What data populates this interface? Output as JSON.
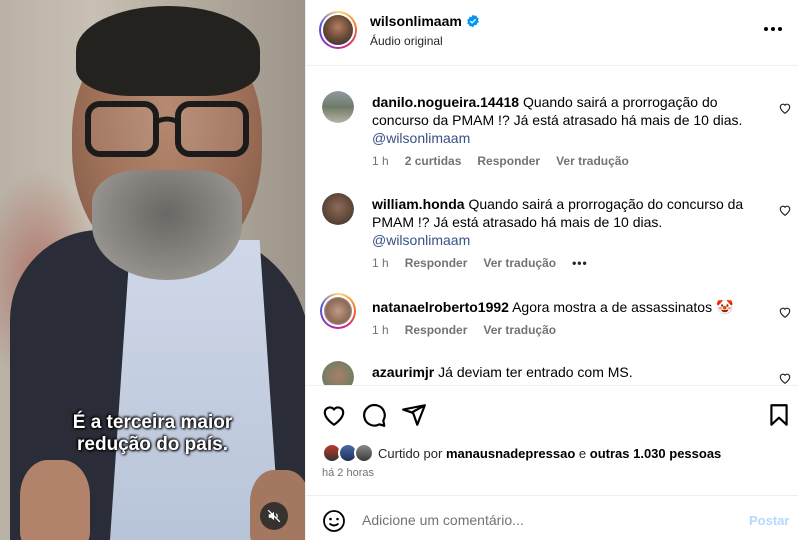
{
  "video": {
    "caption_line1": "É a terceira maior",
    "caption_line2": "redução do país.",
    "mute_icon": "speaker-muted-icon"
  },
  "header": {
    "username": "wilsonlimaam",
    "verified_icon": "verified-badge-icon",
    "subtitle": "Áudio original",
    "more_icon": "more-horizontal-icon"
  },
  "comments": [
    {
      "username": "danilo.nogueira.14418",
      "text": "Quando sairá a prorrogação do concurso da PMAM !? Já está atrasado há mais de 10 dias.",
      "mention": "@wilsonlimaam",
      "time": "1 h",
      "likes": "2 curtidas",
      "reply": "Responder",
      "translate": "Ver tradução"
    },
    {
      "username": "william.honda",
      "text": "Quando sairá a prorrogação do concurso da PMAM !? Já está atrasado há mais de 10 dias.",
      "mention": "@wilsonlimaam",
      "time": "1 h",
      "reply": "Responder",
      "translate": "Ver tradução",
      "more": "•••"
    },
    {
      "username": "natanaelroberto1992",
      "text": "Agora mostra a de assassinatos 🤡",
      "time": "1 h",
      "reply": "Responder",
      "translate": "Ver tradução"
    },
    {
      "username": "azaurimjr",
      "text": "Já deviam ter entrado com MS."
    }
  ],
  "actions": {
    "like_icon": "heart-icon",
    "comment_icon": "comment-icon",
    "share_icon": "send-icon",
    "save_icon": "bookmark-icon",
    "liked_prefix": "Curtido por",
    "liked_user": "manausnadepressao",
    "liked_mid": "e",
    "liked_others": "outras 1.030 pessoas",
    "time_ago": "há 2 horas"
  },
  "add_comment": {
    "emoji_icon": "emoji-icon",
    "placeholder": "Adicione um comentário...",
    "post_label": "Postar"
  },
  "colors": {
    "link": "#385185",
    "muted": "#737373",
    "post_disabled": "#b3dbff",
    "verified": "#0095f6"
  }
}
